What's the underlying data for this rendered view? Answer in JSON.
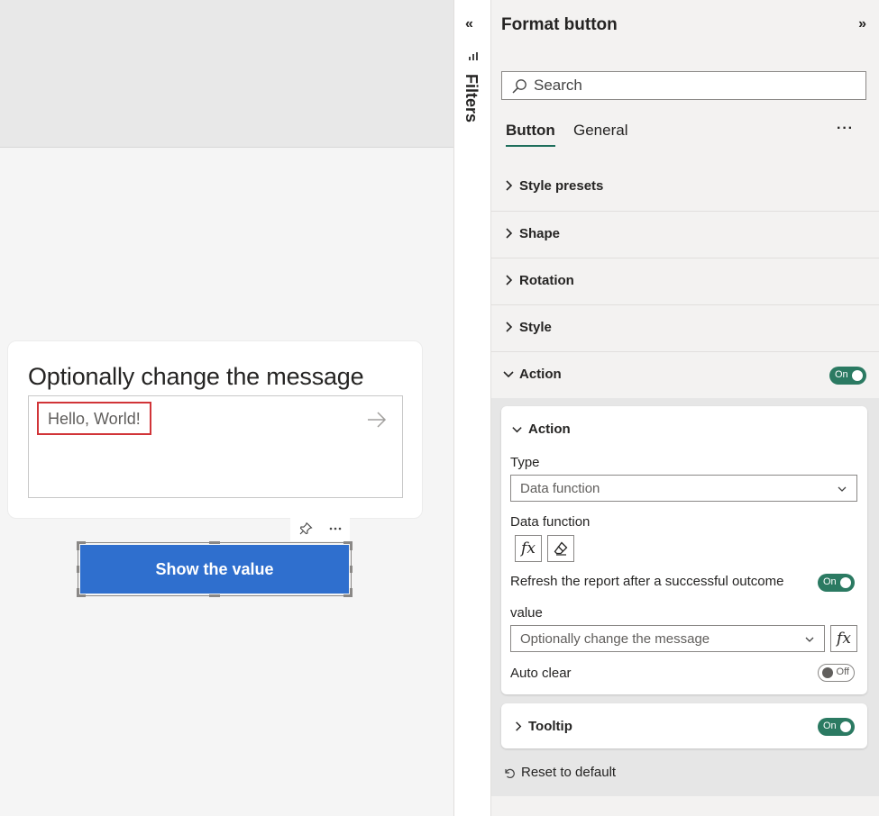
{
  "canvas": {
    "card_title": "Optionally change the message",
    "input_value": "Hello, World!",
    "show_button_label": "Show the value"
  },
  "filters": {
    "label": "Filters"
  },
  "pane": {
    "title": "Format button",
    "search_placeholder": "Search",
    "tabs": [
      {
        "label": "Button",
        "active": true
      },
      {
        "label": "General",
        "active": false
      }
    ],
    "more_options": "···",
    "sections": [
      {
        "label": "Style presets"
      },
      {
        "label": "Shape"
      },
      {
        "label": "Rotation"
      },
      {
        "label": "Style"
      },
      {
        "label": "Action",
        "expanded": true,
        "toggle": "On"
      }
    ],
    "action": {
      "title": "Action",
      "type_label": "Type",
      "type_value": "Data function",
      "data_function_label": "Data function",
      "fx_symbol": "fx",
      "refresh_label": "Refresh the report after a successful outcome",
      "refresh_toggle": "On",
      "value_label": "value",
      "value_selected": "Optionally change the message",
      "auto_clear_label": "Auto clear",
      "auto_clear_toggle": "Off"
    },
    "tooltip": {
      "label": "Tooltip",
      "toggle": "On"
    },
    "reset_label": "Reset to default"
  },
  "colors": {
    "button_blue": "#2f6fce",
    "toggle_green": "#2b7a62",
    "highlight_red": "#d13438",
    "tab_underline": "#1e6f5c"
  }
}
